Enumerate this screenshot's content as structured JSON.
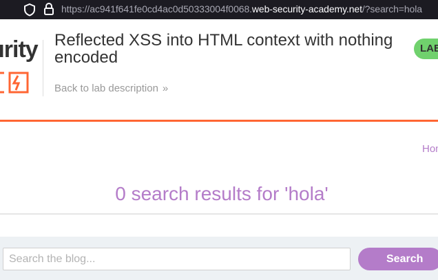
{
  "browser": {
    "url_prefix": "https://ac941f641fe0cd4ac0d50333004f0068.",
    "url_host": "web-security-academy.net",
    "url_suffix": "/?search=hola",
    "shield_icon": "shield-icon",
    "lock_icon": "lock-icon"
  },
  "header": {
    "logo_text": "urity",
    "title": "Reflected XSS into HTML context with nothing encoded",
    "back_link": "Back to lab description",
    "back_chevron": "»",
    "badge": "LAB"
  },
  "nav": {
    "home": "Home"
  },
  "main": {
    "results_heading": "0 search results for 'hola'"
  },
  "search": {
    "placeholder": "Search the blog...",
    "value": "",
    "button_label": "Search"
  },
  "colors": {
    "accent": "#b47cc9",
    "brand_orange": "#ff6633",
    "badge_green": "#70d16d"
  }
}
